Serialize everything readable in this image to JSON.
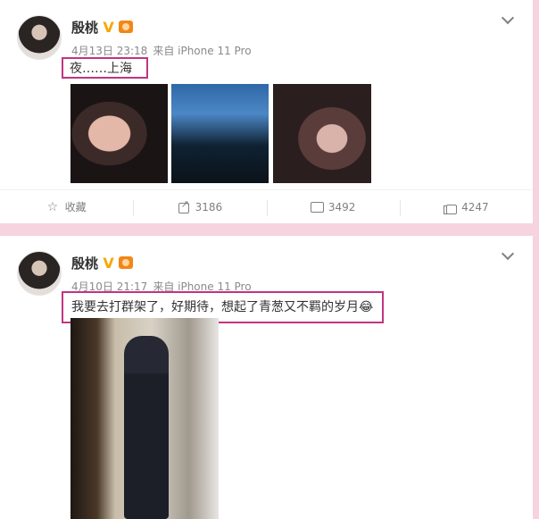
{
  "posts": [
    {
      "author": "殷桃",
      "time": "4月13日 23:18",
      "source": "来自 iPhone 11 Pro",
      "text": "夜……上海",
      "actions": {
        "collect": "收藏",
        "repost": "3186",
        "comment": "3492",
        "like": "4247"
      }
    },
    {
      "author": "殷桃",
      "time": "4月10日 21:17",
      "source": "来自 iPhone 11 Pro",
      "text": "我要去打群架了，好期待，想起了青葱又不羁的岁月😂"
    }
  ],
  "icons": {
    "verified": "verified-icon",
    "vip": "vip-icon",
    "chevron": "chevron-down-icon",
    "collect": "star-icon",
    "repost": "share-icon",
    "comment": "comment-icon",
    "like": "thumb-up-icon"
  },
  "colors": {
    "page_background": "#f6d3df",
    "highlight_border": "#c0357f",
    "verified": "#f7a600"
  }
}
